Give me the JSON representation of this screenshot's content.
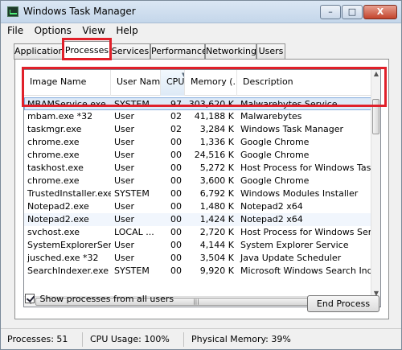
{
  "window": {
    "title": "Windows Task Manager",
    "buttons": {
      "minimize": "–",
      "maximize": "□",
      "close": "X"
    }
  },
  "menu": [
    "File",
    "Options",
    "View",
    "Help"
  ],
  "tabs": [
    "Applications",
    "Processes",
    "Services",
    "Performance",
    "Networking",
    "Users"
  ],
  "active_tab": "Processes",
  "columns": [
    "Image Name",
    "User Name",
    "CPU",
    "Memory (...",
    "Description"
  ],
  "processes": [
    {
      "name": "MBAMService.exe",
      "user": "SYSTEM",
      "cpu": "97",
      "memory": "303,620 K",
      "description": "Malwarebytes Service"
    },
    {
      "name": "mbam.exe *32",
      "user": "User",
      "cpu": "02",
      "memory": "41,188 K",
      "description": "Malwarebytes"
    },
    {
      "name": "taskmgr.exe",
      "user": "User",
      "cpu": "02",
      "memory": "3,284 K",
      "description": "Windows Task Manager"
    },
    {
      "name": "chrome.exe",
      "user": "User",
      "cpu": "00",
      "memory": "1,336 K",
      "description": "Google Chrome"
    },
    {
      "name": "chrome.exe",
      "user": "User",
      "cpu": "00",
      "memory": "24,516 K",
      "description": "Google Chrome"
    },
    {
      "name": "taskhost.exe",
      "user": "User",
      "cpu": "00",
      "memory": "5,272 K",
      "description": "Host Process for Windows Tasks"
    },
    {
      "name": "chrome.exe",
      "user": "User",
      "cpu": "00",
      "memory": "3,600 K",
      "description": "Google Chrome"
    },
    {
      "name": "TrustedInstaller.exe",
      "user": "SYSTEM",
      "cpu": "00",
      "memory": "6,792 K",
      "description": "Windows Modules Installer"
    },
    {
      "name": "Notepad2.exe",
      "user": "User",
      "cpu": "00",
      "memory": "1,480 K",
      "description": "Notepad2 x64"
    },
    {
      "name": "Notepad2.exe",
      "user": "User",
      "cpu": "00",
      "memory": "1,424 K",
      "description": "Notepad2 x64"
    },
    {
      "name": "svchost.exe",
      "user": "LOCAL ...",
      "cpu": "00",
      "memory": "2,720 K",
      "description": "Host Process for Windows Ser..."
    },
    {
      "name": "SystemExplorerSer...",
      "user": "User",
      "cpu": "00",
      "memory": "4,144 K",
      "description": "System Explorer Service"
    },
    {
      "name": "jusched.exe *32",
      "user": "User",
      "cpu": "00",
      "memory": "3,504 K",
      "description": "Java Update Scheduler"
    },
    {
      "name": "SearchIndexer.exe",
      "user": "SYSTEM",
      "cpu": "00",
      "memory": "9,920 K",
      "description": "Microsoft Windows Search Ind..."
    }
  ],
  "show_all_label": "Show processes from all users",
  "show_all_checked": true,
  "end_process_label": "End Process",
  "status": {
    "processes": "Processes: 51",
    "cpu": "CPU Usage: 100%",
    "memory": "Physical Memory: 39%"
  },
  "colors": {
    "highlight": "#e0202a",
    "selected_row": "#dde9f7"
  }
}
